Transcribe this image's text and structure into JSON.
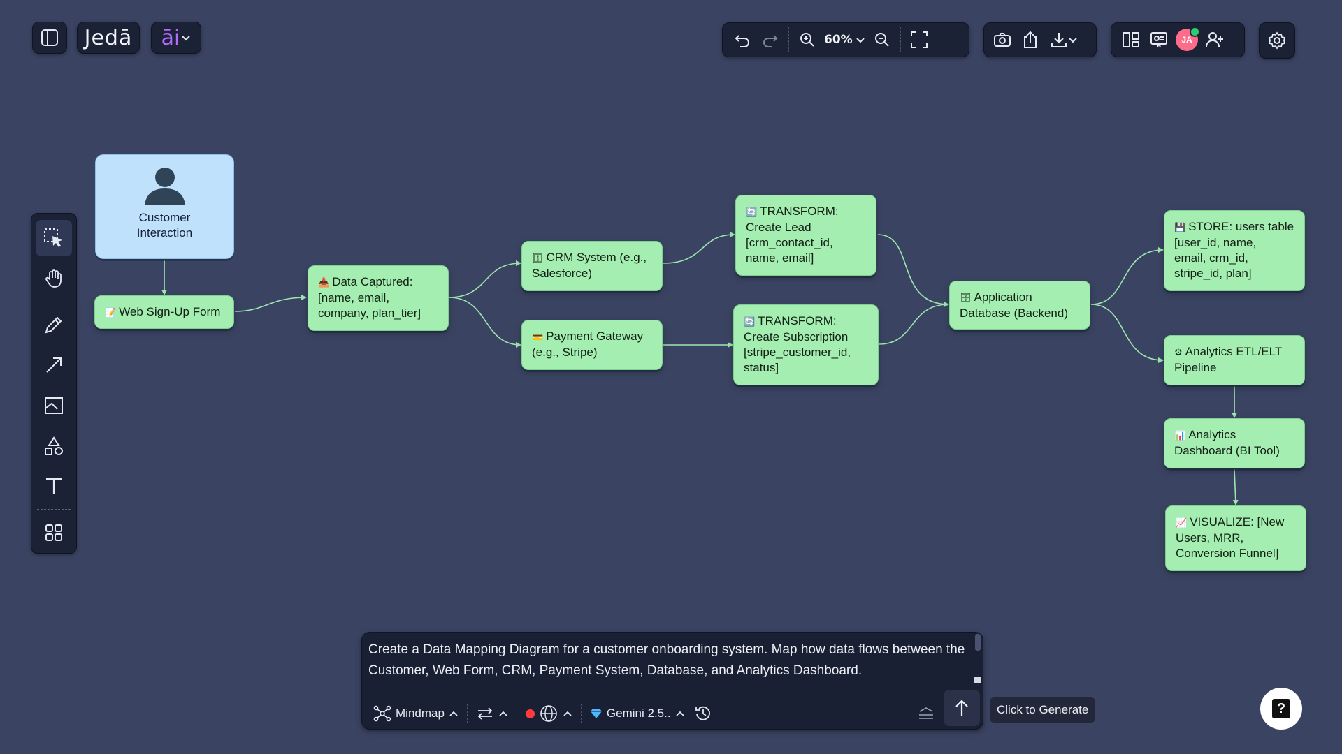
{
  "header": {
    "logo_text": "Jedā",
    "ai_text": "āi",
    "zoom": "60%",
    "avatar_initials": "JA"
  },
  "colors": {
    "background": "#3a4462",
    "node_green": "#a4eeb1",
    "node_blue": "#bfe1fb",
    "edge": "#9ee6b0",
    "logo_accent": "#b46cff",
    "avatar": "#ff6b8a",
    "online_dot": "#2ecc71",
    "record_dot": "#ff3b3b"
  },
  "diagram": {
    "customer": {
      "label_line1": "Customer",
      "label_line2": "Interaction",
      "icon": "user-silhouette-icon"
    },
    "web_form": {
      "emoji": "📝",
      "lines": [
        "Web Sign-Up Form"
      ]
    },
    "data_captured": {
      "emoji": "📥",
      "lines": [
        "Data Captured:",
        "[name, email,",
        "company, plan_tier]"
      ]
    },
    "crm": {
      "emoji": "🗄",
      "lines": [
        "CRM System (e.g.,",
        "Salesforce)"
      ]
    },
    "payment": {
      "emoji": "💳",
      "lines": [
        "Payment Gateway",
        "(e.g., Stripe)"
      ]
    },
    "transform_lead": {
      "emoji": "🔄",
      "lines": [
        "TRANSFORM:",
        "Create Lead",
        "[crm_contact_id,",
        "name, email]"
      ]
    },
    "transform_sub": {
      "emoji": "🔄",
      "lines": [
        "TRANSFORM:",
        "Create Subscription",
        "[stripe_customer_id,",
        "status]"
      ]
    },
    "app_db": {
      "emoji": "🗄",
      "lines": [
        "Application",
        "Database (Backend)"
      ]
    },
    "store": {
      "emoji": "💾",
      "lines": [
        "STORE: users table",
        "[user_id, name,",
        "email, crm_id,",
        "stripe_id, plan]"
      ]
    },
    "etl": {
      "emoji": "⚙",
      "lines": [
        "Analytics ETL/ELT",
        "Pipeline"
      ]
    },
    "bi": {
      "emoji": "📊",
      "lines": [
        "Analytics",
        "Dashboard (BI Tool)"
      ]
    },
    "visualize": {
      "emoji": "📈",
      "lines": [
        "VISUALIZE: [New",
        "Users, MRR,",
        "Conversion Funnel]"
      ]
    }
  },
  "prompt": {
    "text": "Create a Data Mapping Diagram for a customer onboarding system. Map how data flows between the Customer, Web Form, CRM, Payment System, Database, and Analytics Dashboard.",
    "mode_label": "Mindmap",
    "model_label": "Gemini 2.5..",
    "generate_tooltip": "Click to Generate"
  },
  "help": {
    "label": "?"
  }
}
